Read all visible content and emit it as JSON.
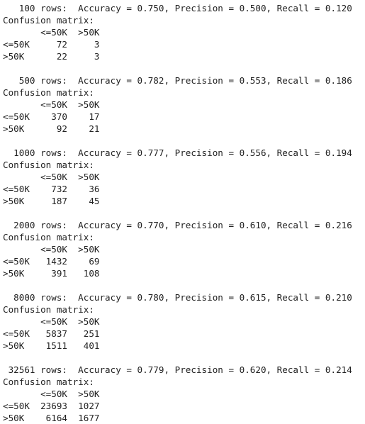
{
  "output_lines": [
    "   100 rows:  Accuracy = 0.750, Precision = 0.500, Recall = 0.120",
    "Confusion matrix:",
    "       <=50K  >50K",
    "<=50K     72     3",
    ">50K      22     3",
    "",
    "   500 rows:  Accuracy = 0.782, Precision = 0.553, Recall = 0.186",
    "Confusion matrix:",
    "       <=50K  >50K",
    "<=50K    370    17",
    ">50K      92    21",
    "",
    "  1000 rows:  Accuracy = 0.777, Precision = 0.556, Recall = 0.194",
    "Confusion matrix:",
    "       <=50K  >50K",
    "<=50K    732    36",
    ">50K     187    45",
    "",
    "  2000 rows:  Accuracy = 0.770, Precision = 0.610, Recall = 0.216",
    "Confusion matrix:",
    "       <=50K  >50K",
    "<=50K   1432    69",
    ">50K     391   108",
    "",
    "  8000 rows:  Accuracy = 0.780, Precision = 0.615, Recall = 0.210",
    "Confusion matrix:",
    "       <=50K  >50K",
    "<=50K   5837   251",
    ">50K    1511   401",
    "",
    " 32561 rows:  Accuracy = 0.779, Precision = 0.620, Recall = 0.214",
    "Confusion matrix:",
    "       <=50K  >50K",
    "<=50K  23693  1027",
    ">50K    6164  1677"
  ]
}
